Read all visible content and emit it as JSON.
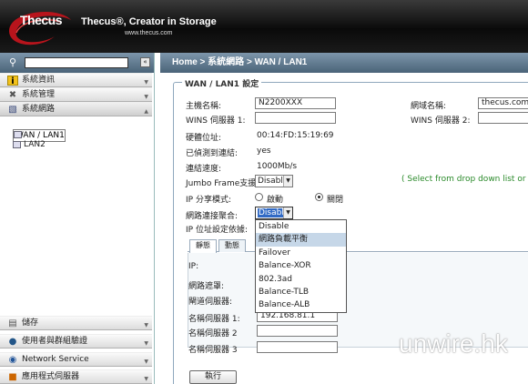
{
  "brand": {
    "logo": "Thecus",
    "slogan": "Thecus®, Creator in Storage",
    "url": "www.thecus.com"
  },
  "sidebar": {
    "search_value": "",
    "collapse_glyph": "«",
    "top_sections": [
      {
        "label": "系統資訊"
      },
      {
        "label": "系統管理"
      },
      {
        "label": "系統網路"
      }
    ],
    "tree": [
      {
        "label": "WAN / LAN1"
      },
      {
        "label": "LAN2"
      }
    ],
    "bottom_sections": [
      {
        "label": "儲存"
      },
      {
        "label": "使用者與群組驗證"
      },
      {
        "label": "Network Service"
      },
      {
        "label": "應用程式伺服器"
      }
    ]
  },
  "breadcrumb": "Home > 系統網路 > WAN / LAN1",
  "form": {
    "legend": "WAN / LAN1 設定",
    "hostname_label": "主機名稱:",
    "hostname_value": "N2200XXX",
    "domain_label": "網域名稱:",
    "domain_value": "thecus.com",
    "wins1_label": "WINS 伺服器 1:",
    "wins1_value": "",
    "wins2_label": "WINS 伺服器 2:",
    "wins2_value": "",
    "mac_label": "硬體位址:",
    "mac_value": "00:14:FD:15:19:69",
    "detected_label": "已偵測到連結:",
    "detected_value": "yes",
    "speed_label": "連結速度:",
    "speed_value": "1000Mb/s",
    "jumbo_label": "Jumbo Frame支援:",
    "jumbo_value": "Disable",
    "hint": "( Select from drop down list or input n",
    "ipshare_label": "IP 分享模式:",
    "ipshare_on": "啟動",
    "ipshare_off": "關閉",
    "agg_label": "網路連接聚合:",
    "agg_value": "Disable",
    "ipsrc_label": "IP 位址設定依據:",
    "tabs": [
      "靜態",
      "動態"
    ],
    "ip_label": "IP:",
    "mask_label": "網路遮罩:",
    "gateway_label": "閘道伺服器:",
    "dns1_label": "名稱伺服器 1:",
    "dns1_value": "192.168.81.1",
    "dns2_label": "名稱伺服器 2",
    "dns2_value": "",
    "dns3_label": "名稱伺服器 3",
    "dns3_value": "",
    "apply": "執行"
  },
  "dropdown_options": [
    "Disable",
    "網路負載平衡",
    "Failover",
    "Balance-XOR",
    "802.3ad",
    "Balance-TLB",
    "Balance-ALB"
  ],
  "watermark": "unwire.hk"
}
